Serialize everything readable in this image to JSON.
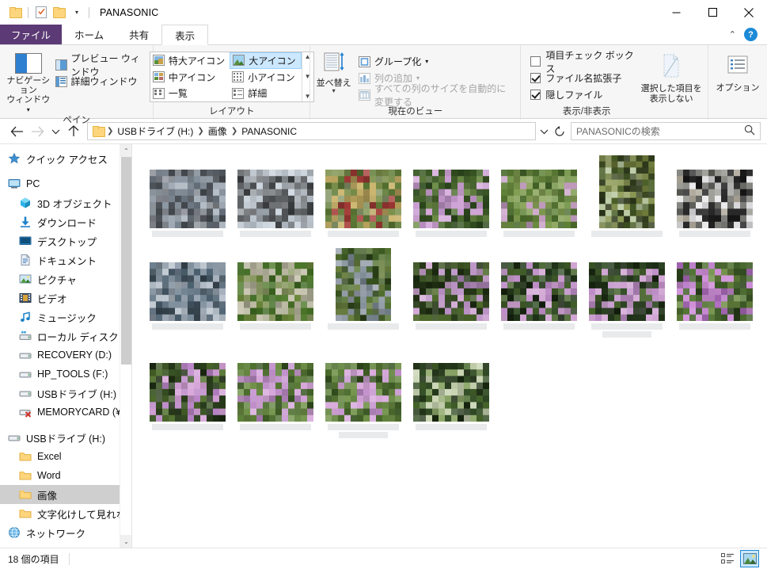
{
  "window": {
    "title": "PANASONIC",
    "quick_access": [
      {
        "name": "folder-icon",
        "label": "folder"
      },
      {
        "name": "properties-icon",
        "label": "properties"
      },
      {
        "name": "new-folder-icon",
        "label": "new folder"
      }
    ],
    "controls": {
      "minimize": "minimize",
      "maximize": "maximize",
      "close": "close"
    }
  },
  "tabs": {
    "file": "ファイル",
    "items": [
      {
        "label": "ホーム",
        "active": false
      },
      {
        "label": "共有",
        "active": false
      },
      {
        "label": "表示",
        "active": true
      }
    ],
    "collapse_icon": "chevron-up-icon",
    "help_icon": "?"
  },
  "ribbon": {
    "groups": [
      {
        "id": "panes",
        "title": "ペイン",
        "big_button": {
          "label_line1": "ナビゲーション",
          "label_line2": "ウィンドウ",
          "has_dropdown": true
        },
        "items": [
          {
            "label": "プレビュー ウィンドウ"
          },
          {
            "label": "詳細ウィンドウ"
          }
        ]
      },
      {
        "id": "layout",
        "title": "レイアウト",
        "gallery": [
          {
            "label": "特大アイコン",
            "selected": false
          },
          {
            "label": "大アイコン",
            "selected": true
          },
          {
            "label": "中アイコン",
            "selected": false
          },
          {
            "label": "小アイコン",
            "selected": false
          },
          {
            "label": "一覧",
            "selected": false
          },
          {
            "label": "詳細",
            "selected": false
          }
        ],
        "scroll": {
          "up": "▲",
          "down": "▼",
          "more": "▼"
        }
      },
      {
        "id": "current-view",
        "title": "現在のビュー",
        "sort_button": {
          "label": "並べ替え"
        },
        "items": [
          {
            "label": "グループ化",
            "dropdown": true,
            "disabled": false
          },
          {
            "label": "列の追加",
            "dropdown": true,
            "disabled": true
          },
          {
            "label": "すべての列のサイズを自動的に変更する",
            "dropdown": false,
            "disabled": true
          }
        ]
      },
      {
        "id": "show-hide",
        "title": "表示/非表示",
        "checkboxes": [
          {
            "label": "項目チェック ボックス",
            "checked": false
          },
          {
            "label": "ファイル名拡張子",
            "checked": true
          },
          {
            "label": "隠しファイル",
            "checked": true
          }
        ],
        "hide_selected": {
          "label_line1": "選択した項目を",
          "label_line2": "表示しない"
        }
      },
      {
        "id": "options",
        "title": "",
        "button": {
          "label": "オプション"
        }
      }
    ]
  },
  "addressbar": {
    "back": "←",
    "forward": "→",
    "recent": "⌄",
    "up": "↑",
    "breadcrumbs": [
      "USBドライブ (H:)",
      "画像",
      "PANASONIC"
    ],
    "dropdown": "⌄",
    "refresh": "↻",
    "search": {
      "placeholder": "PANASONICの検索",
      "icon": "search-icon"
    }
  },
  "sidebar": {
    "items": [
      {
        "label": "クイック アクセス",
        "icon": "star-icon",
        "indent": 0,
        "selected": false
      },
      {
        "gap": true
      },
      {
        "label": "PC",
        "icon": "pc-icon",
        "indent": 0,
        "selected": false
      },
      {
        "label": "3D オブジェクト",
        "icon": "3d-objects-icon",
        "indent": 1,
        "selected": false
      },
      {
        "label": "ダウンロード",
        "icon": "downloads-icon",
        "indent": 1,
        "selected": false
      },
      {
        "label": "デスクトップ",
        "icon": "desktop-icon",
        "indent": 1,
        "selected": false
      },
      {
        "label": "ドキュメント",
        "icon": "documents-icon",
        "indent": 1,
        "selected": false
      },
      {
        "label": "ピクチャ",
        "icon": "pictures-icon",
        "indent": 1,
        "selected": false
      },
      {
        "label": "ビデオ",
        "icon": "videos-icon",
        "indent": 1,
        "selected": false
      },
      {
        "label": "ミュージック",
        "icon": "music-icon",
        "indent": 1,
        "selected": false
      },
      {
        "label": "ローカル ディスク (C:)",
        "icon": "local-disk-icon",
        "indent": 1,
        "selected": false
      },
      {
        "label": "RECOVERY (D:)",
        "icon": "drive-icon",
        "indent": 1,
        "selected": false
      },
      {
        "label": "HP_TOOLS (F:)",
        "icon": "drive-icon",
        "indent": 1,
        "selected": false
      },
      {
        "label": "USBドライブ (H:)",
        "icon": "drive-icon",
        "indent": 1,
        "selected": false
      },
      {
        "label": "MEMORYCARD (¥¥",
        "icon": "disconnected-drive-icon",
        "indent": 1,
        "selected": false
      },
      {
        "gap": true
      },
      {
        "label": "USBドライブ (H:)",
        "icon": "drive-icon",
        "indent": 0,
        "selected": false
      },
      {
        "label": "Excel",
        "icon": "folder-icon",
        "indent": 1,
        "selected": false
      },
      {
        "label": "Word",
        "icon": "folder-icon",
        "indent": 1,
        "selected": false
      },
      {
        "label": "画像",
        "icon": "folder-icon",
        "indent": 1,
        "selected": true
      },
      {
        "label": "文字化けして見れない",
        "icon": "folder-icon",
        "indent": 1,
        "selected": false
      },
      {
        "label": "ネットワーク",
        "icon": "network-icon",
        "indent": 0,
        "selected": false
      }
    ],
    "scrollbar": {
      "up": "⌃",
      "down": "⌄"
    }
  },
  "files": {
    "count_label": "18 個の項目",
    "items": [
      {
        "id": 1,
        "orientation": "landscape",
        "palette": [
          "#8d9299",
          "#5b6168",
          "#6f7a86",
          "#4a5056",
          "#8e9aa6",
          "#a8b2bc"
        ],
        "name_lines": 1
      },
      {
        "id": 2,
        "orientation": "landscape",
        "palette": [
          "#b9c2cb",
          "#cdd5dd",
          "#55585b",
          "#6e7275",
          "#9aa0a6",
          "#3f4245"
        ],
        "name_lines": 1
      },
      {
        "id": 3,
        "orientation": "landscape",
        "palette": [
          "#5d7a35",
          "#7a8f4a",
          "#c9b36a",
          "#b8a25c",
          "#8a9a6b",
          "#a43b36"
        ],
        "name_lines": 1
      },
      {
        "id": 4,
        "orientation": "landscape",
        "palette": [
          "#4a6b2e",
          "#3c5a26",
          "#d3a6d8",
          "#c79ad0",
          "#6b8a45",
          "#2e4a1e"
        ],
        "name_lines": 1
      },
      {
        "id": 5,
        "orientation": "landscape",
        "palette": [
          "#5d8036",
          "#6f9142",
          "#88a258",
          "#c9a2c7",
          "#47682a",
          "#7e9b4e"
        ],
        "name_lines": 1
      },
      {
        "id": 6,
        "orientation": "portrait",
        "palette": [
          "#4a5f28",
          "#6d7a3a",
          "#2f3a1c",
          "#8c9a56",
          "#b8c8a0",
          "#3d4a22"
        ],
        "name_lines": 1
      },
      {
        "id": 7,
        "orientation": "landscape",
        "palette": [
          "#1a1a1a",
          "#2b2b2b",
          "#e8e8ea",
          "#9a9a95",
          "#b0aa9c",
          "#6a6a66"
        ],
        "name_lines": 1
      },
      {
        "id": 8,
        "orientation": "landscape",
        "palette": [
          "#9aa7b4",
          "#b6c0ca",
          "#4e6372",
          "#6d7f8e",
          "#8795a3",
          "#3a4954"
        ],
        "name_lines": 1
      },
      {
        "id": 9,
        "orientation": "landscape",
        "palette": [
          "#c2bfa8",
          "#4f7a2c",
          "#3f6a22",
          "#8a9a62",
          "#b5b49c",
          "#6d8a3c"
        ],
        "name_lines": 1
      },
      {
        "id": 10,
        "orientation": "portrait",
        "palette": [
          "#52702f",
          "#3c5a22",
          "#9aa3ae",
          "#7d8a95",
          "#6a8040",
          "#2d4418"
        ],
        "name_lines": 1
      },
      {
        "id": 11,
        "orientation": "landscape",
        "palette": [
          "#2a3d1a",
          "#3c5424",
          "#d0a8d4",
          "#b98fc4",
          "#4e6a2c",
          "#1e2e12"
        ],
        "name_lines": 1
      },
      {
        "id": 12,
        "orientation": "landscape",
        "palette": [
          "#22361a",
          "#35502a",
          "#cfa2d2",
          "#bd8cc6",
          "#46632c",
          "#16240f"
        ],
        "name_lines": 1
      },
      {
        "id": 13,
        "orientation": "landscape",
        "palette": [
          "#22361a",
          "#35502a",
          "#cfa2d2",
          "#bd8cc6",
          "#46632c",
          "#16240f"
        ],
        "name_lines": 2
      },
      {
        "id": 14,
        "orientation": "landscape",
        "palette": [
          "#3f5e28",
          "#527434",
          "#cf8fd8",
          "#b470c4",
          "#6b8a40",
          "#2a401a"
        ],
        "name_lines": 1
      },
      {
        "id": 15,
        "orientation": "landscape",
        "palette": [
          "#2a3e1c",
          "#3e5828",
          "#d4a0d6",
          "#bb86c8",
          "#52702f",
          "#1c2a12"
        ],
        "name_lines": 1
      },
      {
        "id": 16,
        "orientation": "landscape",
        "palette": [
          "#4a6c2c",
          "#5d8038",
          "#d6a6da",
          "#c290cc",
          "#6f9046",
          "#35521f"
        ],
        "name_lines": 1
      },
      {
        "id": 17,
        "orientation": "landscape",
        "palette": [
          "#4a6c2c",
          "#5d8038",
          "#d6a6da",
          "#c290cc",
          "#6f9046",
          "#35521f"
        ],
        "name_lines": 2
      },
      {
        "id": 18,
        "orientation": "landscape",
        "palette": [
          "#24381a",
          "#37522a",
          "#8ea86a",
          "#c7d3b0",
          "#47682c",
          "#1a2a10"
        ],
        "name_lines": 1
      }
    ]
  },
  "statusbar": {
    "count": "18 個の項目",
    "view_buttons": [
      {
        "name": "details-view-button",
        "selected": false
      },
      {
        "name": "large-icons-view-button",
        "selected": true
      }
    ]
  },
  "colors": {
    "file_tab": "#5b3a75",
    "selection": "#cce8ff",
    "selection_border": "#99d1ff",
    "sidebar_selected": "#cfcfcf",
    "accent_blue": "#1c8ad6",
    "folder_yellow": "#fdd57d"
  }
}
